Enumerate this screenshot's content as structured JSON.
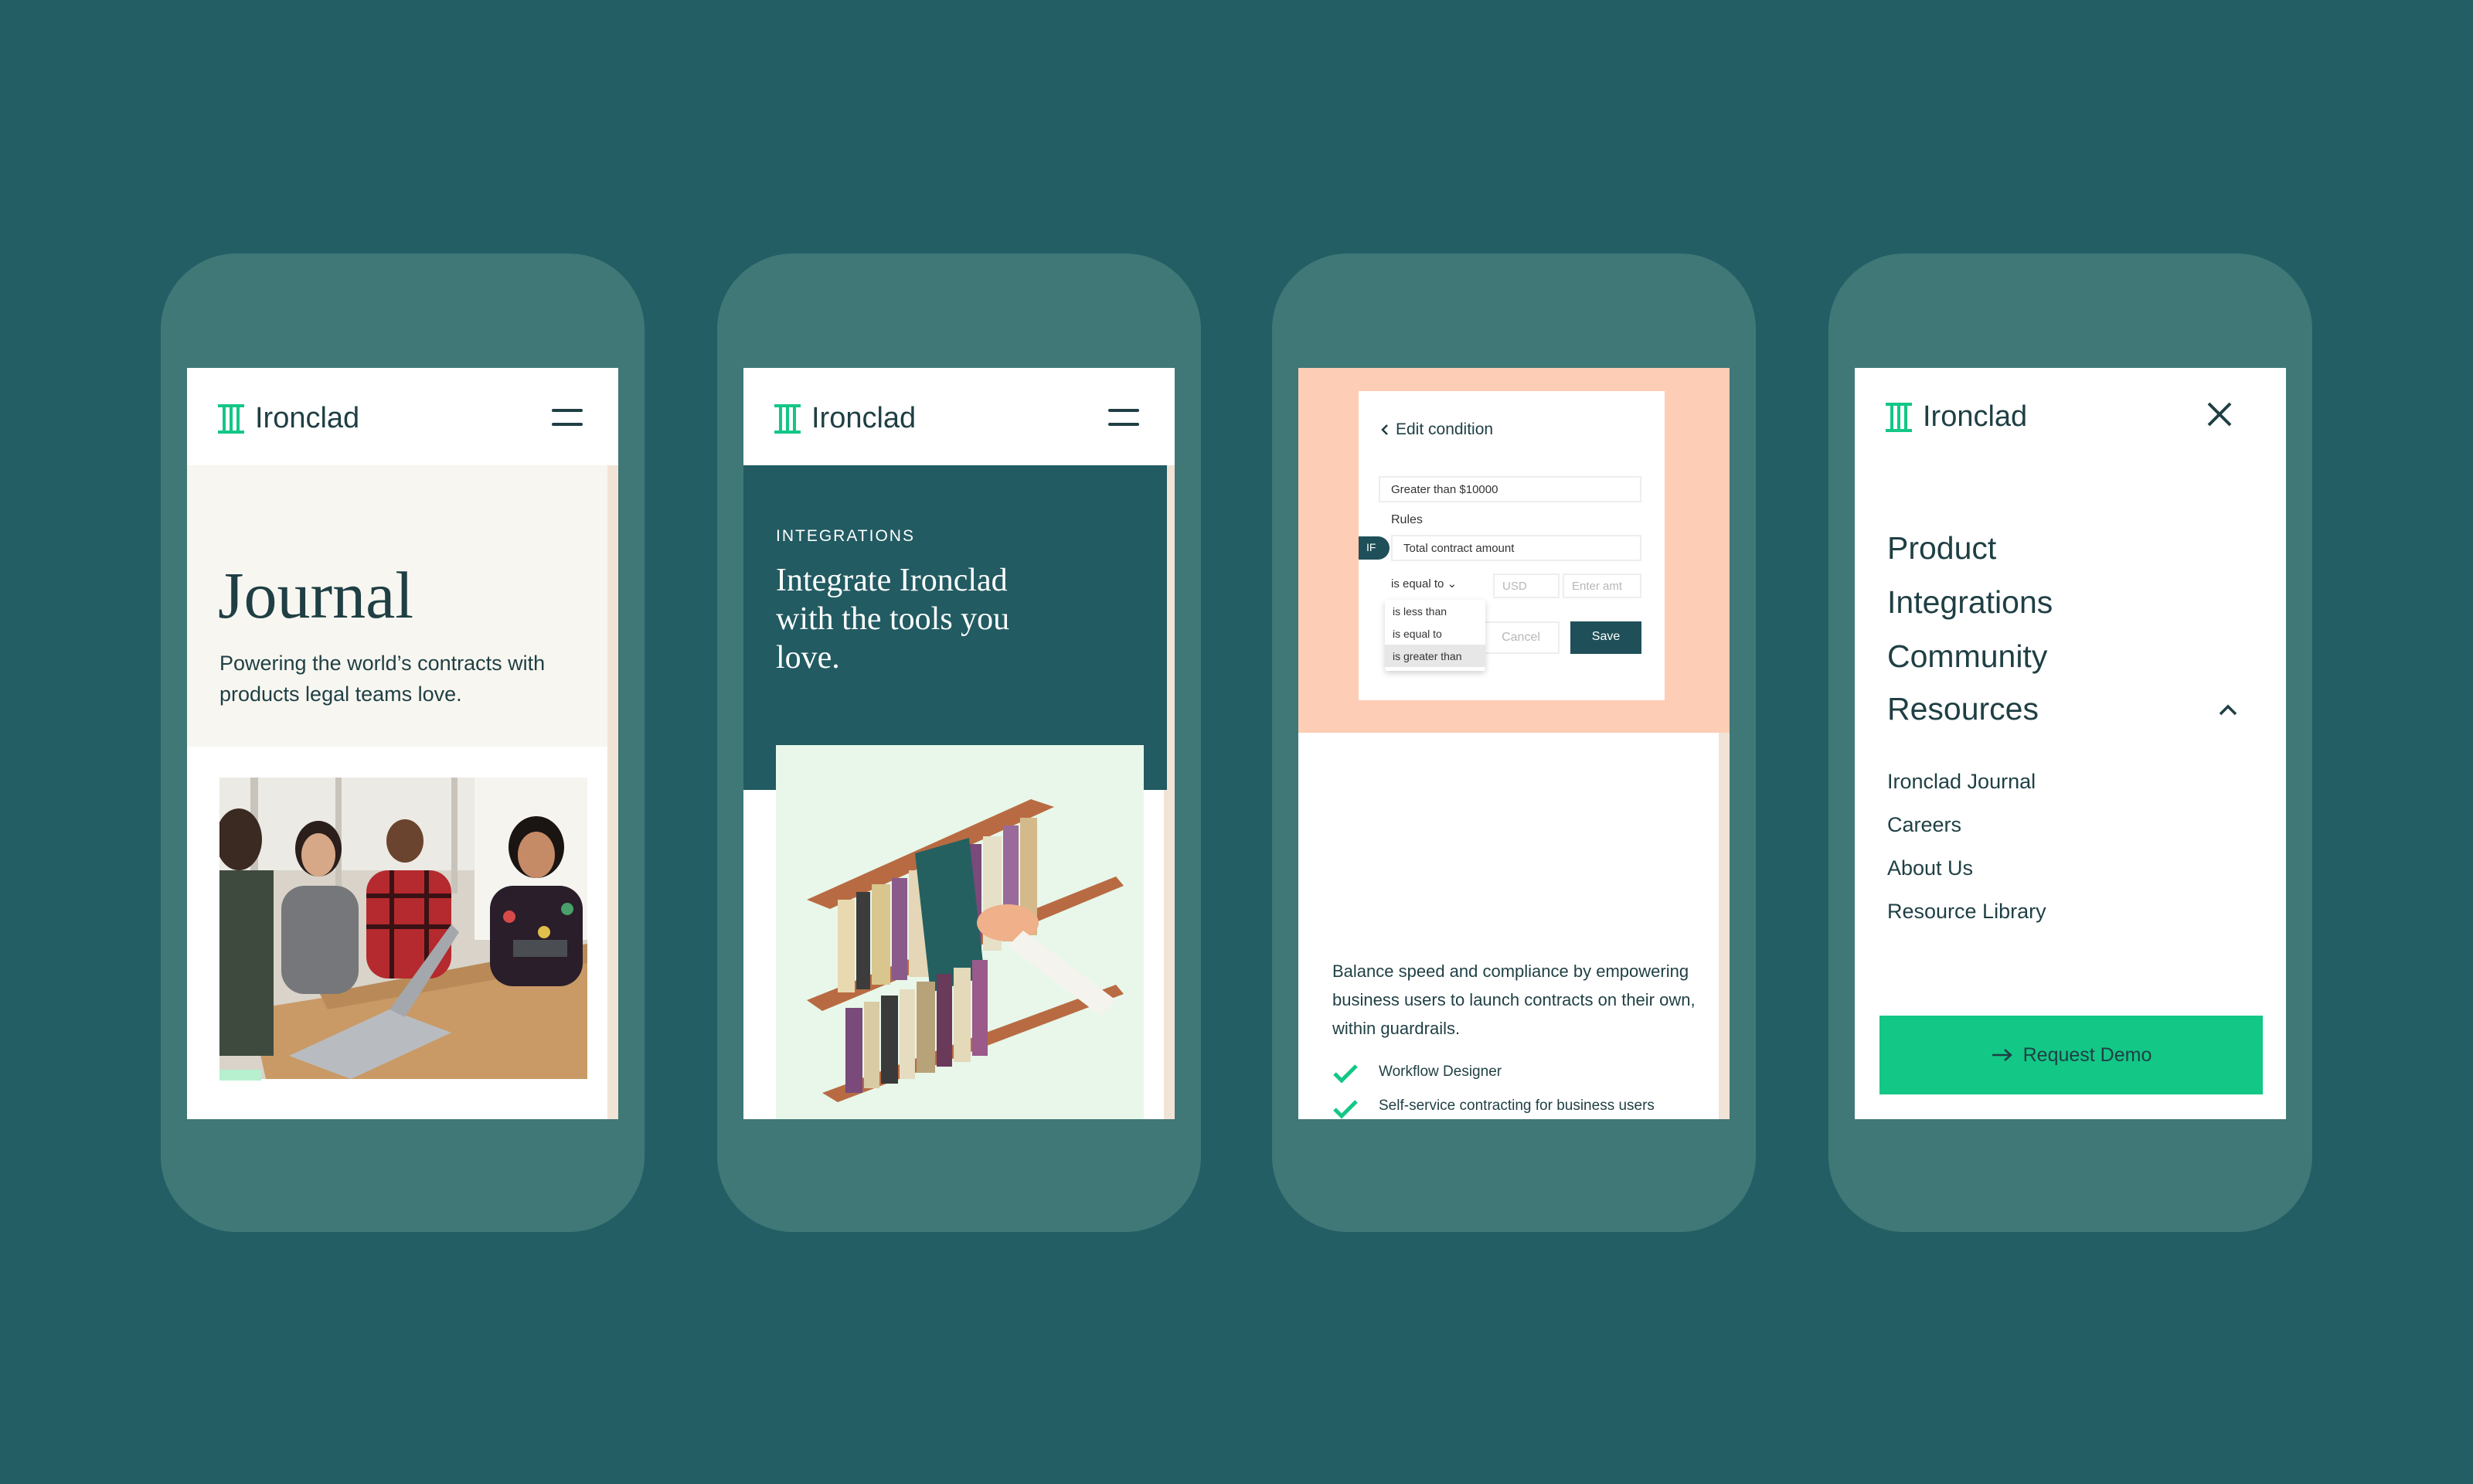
{
  "brand": {
    "name": "Ironclad",
    "accent": "#13c786",
    "primary": "#225b62",
    "background": "#235e65",
    "peach": "#fecdb5"
  },
  "journal_screen": {
    "title": "Journal",
    "subtitle": "Powering the world’s contracts with products legal teams love.",
    "menu_icon": "hamburger-icon"
  },
  "integrations_screen": {
    "eyebrow": "INTEGRATIONS",
    "title": "Integrate Ironclad with the tools you love."
  },
  "workflow_screen": {
    "dialog": {
      "title": "Edit condition",
      "name_value": "Greater than $10000",
      "rules_label": "Rules",
      "if_badge": "IF",
      "field_value": "Total contract amount",
      "operator_value": "is equal to",
      "operator_options": [
        "is less than",
        "is equal to",
        "is greater than"
      ],
      "currency_placeholder": "USD",
      "amount_placeholder": "Enter amt",
      "cancel_label": "Cancel",
      "save_label": "Save"
    },
    "body": "Balance speed and compliance by empowering business users to launch contracts on their own, within guardrails.",
    "features": [
      "Workflow Designer",
      "Self-service contracting for business users"
    ]
  },
  "menu_screen": {
    "nav_items": [
      "Product",
      "Integrations",
      "Community",
      "Resources"
    ],
    "resources_items": [
      "Ironclad Journal",
      "Careers",
      "About Us",
      "Resource Library"
    ],
    "cta_label": "Request Demo"
  }
}
